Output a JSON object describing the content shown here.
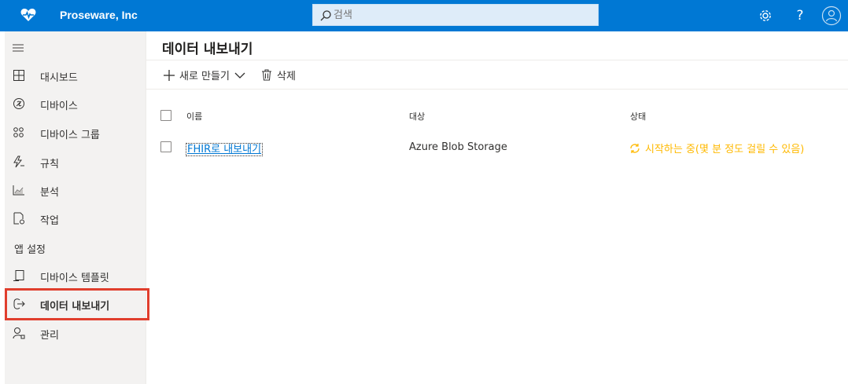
{
  "app": {
    "brand_name": "Proseware, Inc",
    "brand_color": "#0078d4"
  },
  "search": {
    "placeholder": "검색",
    "value": ""
  },
  "topbar_icons": [
    "settings-icon",
    "help-icon",
    "account-icon"
  ],
  "help_label": "?",
  "sidebar": {
    "items": [
      {
        "label": "대시보드",
        "icon": "dashboard-icon"
      },
      {
        "label": "디바이스",
        "icon": "devices-icon"
      },
      {
        "label": "디바이스 그룹",
        "icon": "device-groups-icon"
      },
      {
        "label": "규칙",
        "icon": "rules-icon"
      },
      {
        "label": "분석",
        "icon": "analytics-icon"
      },
      {
        "label": "작업",
        "icon": "jobs-icon"
      }
    ],
    "section_label": "앱 설정",
    "settings_items": [
      {
        "label": "디바이스 템플릿",
        "icon": "device-template-icon"
      },
      {
        "label": "데이터 내보내기",
        "icon": "data-export-icon",
        "active": true
      },
      {
        "label": "관리",
        "icon": "admin-icon"
      }
    ]
  },
  "main": {
    "title": "데이터 내보내기",
    "toolbar": {
      "new_label": "새로 만들기",
      "delete_label": "삭제"
    },
    "table": {
      "headers": {
        "name": "이름",
        "target": "대상",
        "status": "상태"
      },
      "rows": [
        {
          "name": "FHIR로 내보내기",
          "target": "Azure Blob Storage",
          "status": "시작하는 중(몇 분 정도 걸릴 수 있음)"
        }
      ]
    }
  },
  "colors": {
    "status_starting": "#ffb900",
    "highlight": "#e03e2d",
    "link": "#0078d4"
  }
}
